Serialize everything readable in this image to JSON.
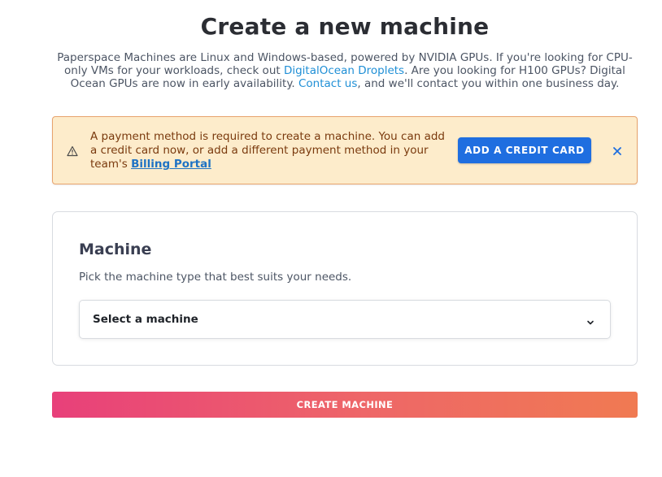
{
  "page": {
    "title": "Create a new machine",
    "intro": {
      "part1": "Paperspace Machines are Linux and Windows-based, powered by NVIDIA GPUs. If you're looking for CPU-only VMs for your workloads, check out ",
      "link1": "DigitalOcean Droplets",
      "part2": ". Are you looking for H100 GPUs? Digital Ocean GPUs are now in early availability. ",
      "link2": "Contact us",
      "part3": ", and we'll contact you within one business day."
    }
  },
  "alert": {
    "icon": "warning-triangle-icon",
    "text": "A payment method is required to create a machine. You can add a credit card now, or add a different payment method in your team's ",
    "link": "Billing Portal",
    "button_label": "ADD A CREDIT CARD",
    "close_icon": "close-icon"
  },
  "machine_card": {
    "title": "Machine",
    "subtitle": "Pick the machine type that best suits your needs.",
    "select_value": "Select a machine",
    "select_icon": "chevron-down-icon"
  },
  "create_button": {
    "label": "CREATE MACHINE"
  },
  "colors": {
    "alert_bg": "#fdeccb",
    "alert_border": "#e8a36d",
    "primary_button": "#1f6ee0",
    "link": "#1f8fd6",
    "gradient_start": "#e8407a",
    "gradient_end": "#f07a52"
  }
}
